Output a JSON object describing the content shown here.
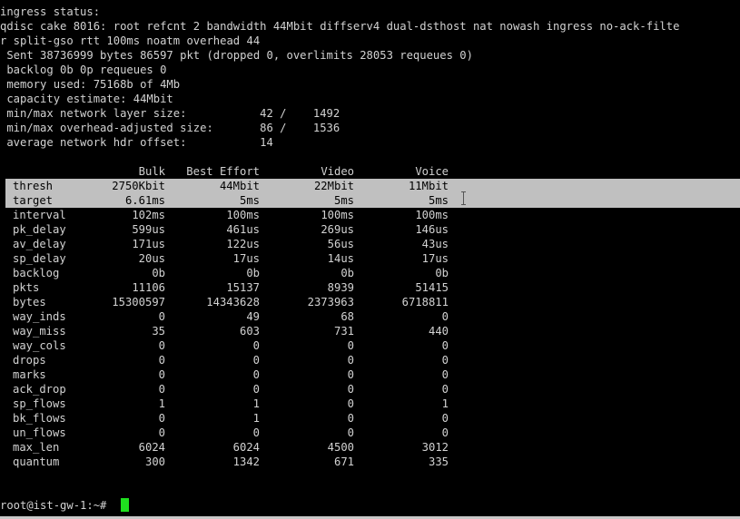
{
  "header": {
    "lines": [
      "ingress status:",
      "qdisc cake 8016: root refcnt 2 bandwidth 44Mbit diffserv4 dual-dsthost nat nowash ingress no-ack-filte",
      "r split-gso rtt 100ms noatm overhead 44",
      " Sent 38736999 bytes 86597 pkt (dropped 0, overlimits 28053 requeues 0)",
      " backlog 0b 0p requeues 0",
      " memory used: 75168b of 4Mb",
      " capacity estimate: 44Mbit",
      " min/max network layer size:           42 /    1492",
      " min/max overhead-adjusted size:       86 /    1536",
      " average network hdr offset:           14"
    ]
  },
  "stats_table": {
    "columns": [
      "Bulk",
      "Best Effort",
      "Video",
      "Voice"
    ],
    "rows": [
      {
        "label": "thresh",
        "values": [
          "2750Kbit",
          "44Mbit",
          "22Mbit",
          "11Mbit"
        ]
      },
      {
        "label": "target",
        "values": [
          "6.61ms",
          "5ms",
          "5ms",
          "5ms"
        ]
      },
      {
        "label": "interval",
        "values": [
          "102ms",
          "100ms",
          "100ms",
          "100ms"
        ]
      },
      {
        "label": "pk_delay",
        "values": [
          "599us",
          "461us",
          "269us",
          "146us"
        ]
      },
      {
        "label": "av_delay",
        "values": [
          "171us",
          "122us",
          "56us",
          "43us"
        ]
      },
      {
        "label": "sp_delay",
        "values": [
          "20us",
          "17us",
          "14us",
          "17us"
        ]
      },
      {
        "label": "backlog",
        "values": [
          "0b",
          "0b",
          "0b",
          "0b"
        ]
      },
      {
        "label": "pkts",
        "values": [
          "11106",
          "15137",
          "8939",
          "51415"
        ]
      },
      {
        "label": "bytes",
        "values": [
          "15300597",
          "14343628",
          "2373963",
          "6718811"
        ]
      },
      {
        "label": "way_inds",
        "values": [
          "0",
          "49",
          "68",
          "0"
        ]
      },
      {
        "label": "way_miss",
        "values": [
          "35",
          "603",
          "731",
          "440"
        ]
      },
      {
        "label": "way_cols",
        "values": [
          "0",
          "0",
          "0",
          "0"
        ]
      },
      {
        "label": "drops",
        "values": [
          "0",
          "0",
          "0",
          "0"
        ]
      },
      {
        "label": "marks",
        "values": [
          "0",
          "0",
          "0",
          "0"
        ]
      },
      {
        "label": "ack_drop",
        "values": [
          "0",
          "0",
          "0",
          "0"
        ]
      },
      {
        "label": "sp_flows",
        "values": [
          "1",
          "1",
          "0",
          "1"
        ]
      },
      {
        "label": "bk_flows",
        "values": [
          "0",
          "1",
          "0",
          "0"
        ]
      },
      {
        "label": "un_flows",
        "values": [
          "0",
          "0",
          "0",
          "0"
        ]
      },
      {
        "label": "max_len",
        "values": [
          "6024",
          "6024",
          "4500",
          "3012"
        ]
      },
      {
        "label": "quantum",
        "values": [
          "300",
          "1342",
          "671",
          "335"
        ]
      }
    ]
  },
  "prompt": {
    "text": "root@ist-gw-1:~# "
  },
  "colors": {
    "background": "#000000",
    "foreground": "#d2d2d2",
    "selection": "#c0c0c0",
    "cursor": "#1fe01f"
  }
}
